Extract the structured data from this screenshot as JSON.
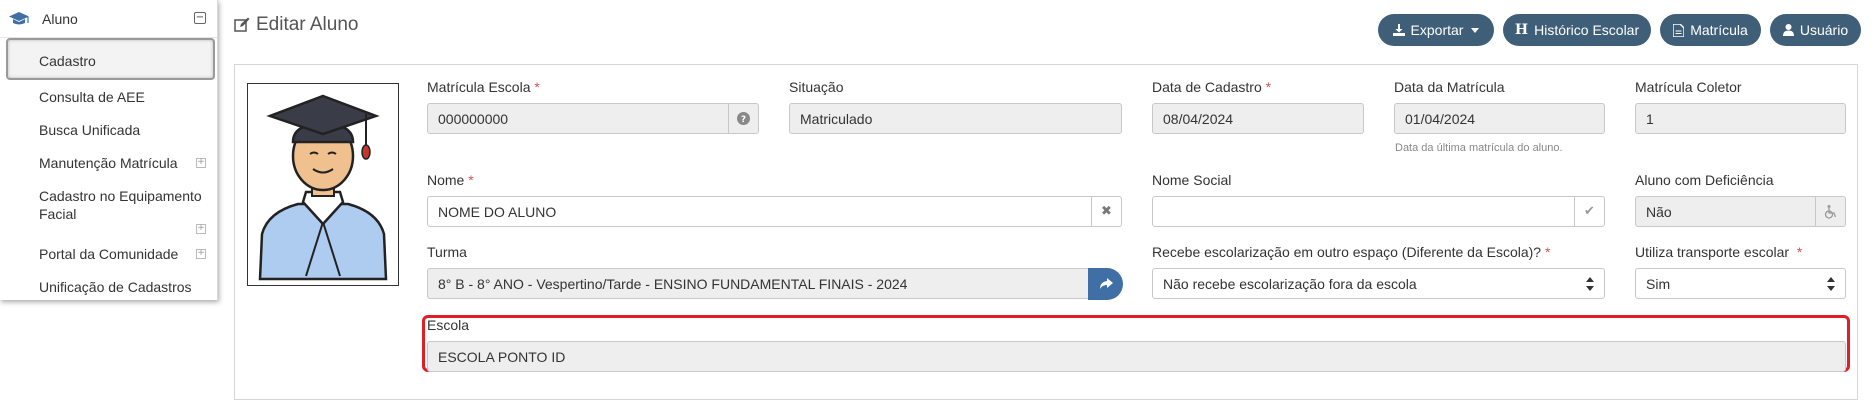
{
  "menu": {
    "header_label": "Aluno",
    "items": [
      {
        "label": "Cadastro"
      },
      {
        "label": "Consulta de AEE"
      },
      {
        "label": "Busca Unificada"
      },
      {
        "label": "Manutenção Matrícula"
      },
      {
        "label_line1": "Cadastro no Equipamento",
        "label_line2": "Facial"
      },
      {
        "label": "Portal da Comunidade"
      },
      {
        "label": "Unificação de Cadastros"
      }
    ]
  },
  "page": {
    "title": "Editar Aluno"
  },
  "toolbar": {
    "exportar": "Exportar",
    "historico": "Histórico Escolar",
    "matricula": "Matrícula",
    "usuario": "Usuário"
  },
  "form": {
    "matricula_escola": {
      "label": "Matrícula Escola",
      "value": "000000000"
    },
    "situacao": {
      "label": "Situação",
      "value": "Matriculado"
    },
    "data_cadastro": {
      "label": "Data de Cadastro",
      "value": "08/04/2024"
    },
    "data_matricula": {
      "label": "Data da Matrícula",
      "value": "01/04/2024",
      "hint": "Data da última matrícula do aluno."
    },
    "matricula_coletor": {
      "label": "Matrícula Coletor",
      "value": "1"
    },
    "nome": {
      "label": "Nome",
      "value": "NOME DO ALUNO"
    },
    "nome_social": {
      "label": "Nome Social",
      "value": ""
    },
    "aluno_deficiencia": {
      "label": "Aluno com Deficiência",
      "value": "Não"
    },
    "turma": {
      "label": "Turma",
      "value": "8° B - 8° ANO - Vespertino/Tarde - ENSINO FUNDAMENTAL FINAIS - 2024"
    },
    "escolarizacao": {
      "label": "Recebe escolarização em outro espaço (Diferente da Escola)?",
      "value": "Não recebe escolarização fora da escola"
    },
    "transporte": {
      "label": "Utiliza transporte escolar",
      "value": "Sim"
    },
    "escola": {
      "label": "Escola",
      "value": "ESCOLA PONTO ID"
    },
    "required_mark": "*"
  },
  "colors": {
    "primary_button": "#3f5f78",
    "turma_button": "#3f6fa5",
    "highlight": "#e01e24",
    "required": "#d9534f"
  }
}
